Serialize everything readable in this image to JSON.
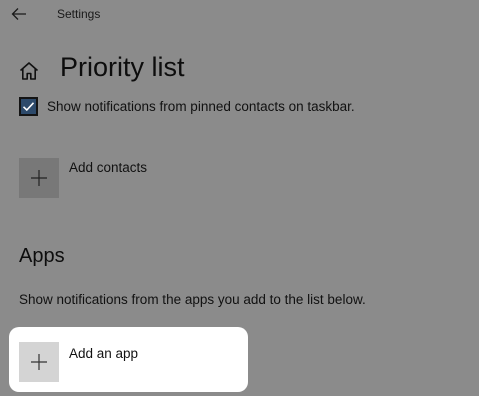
{
  "window": {
    "title": "Settings",
    "back_icon": "arrow-left-icon"
  },
  "page": {
    "home_icon": "home-icon",
    "title": "Priority list"
  },
  "pinned_contacts": {
    "checkbox_checked": true,
    "checkbox_label": "Show notifications from pinned contacts on taskbar.",
    "add_contacts_label": "Add contacts",
    "add_icon": "plus-icon"
  },
  "apps": {
    "heading": "Apps",
    "description": "Show notifications from the apps you add to the list below.",
    "add_app_label": "Add an app",
    "add_icon": "plus-icon"
  },
  "colors": {
    "background": "#8b8b8b",
    "checkbox_fill": "#2d4a6b",
    "highlight": "#ffffff"
  }
}
